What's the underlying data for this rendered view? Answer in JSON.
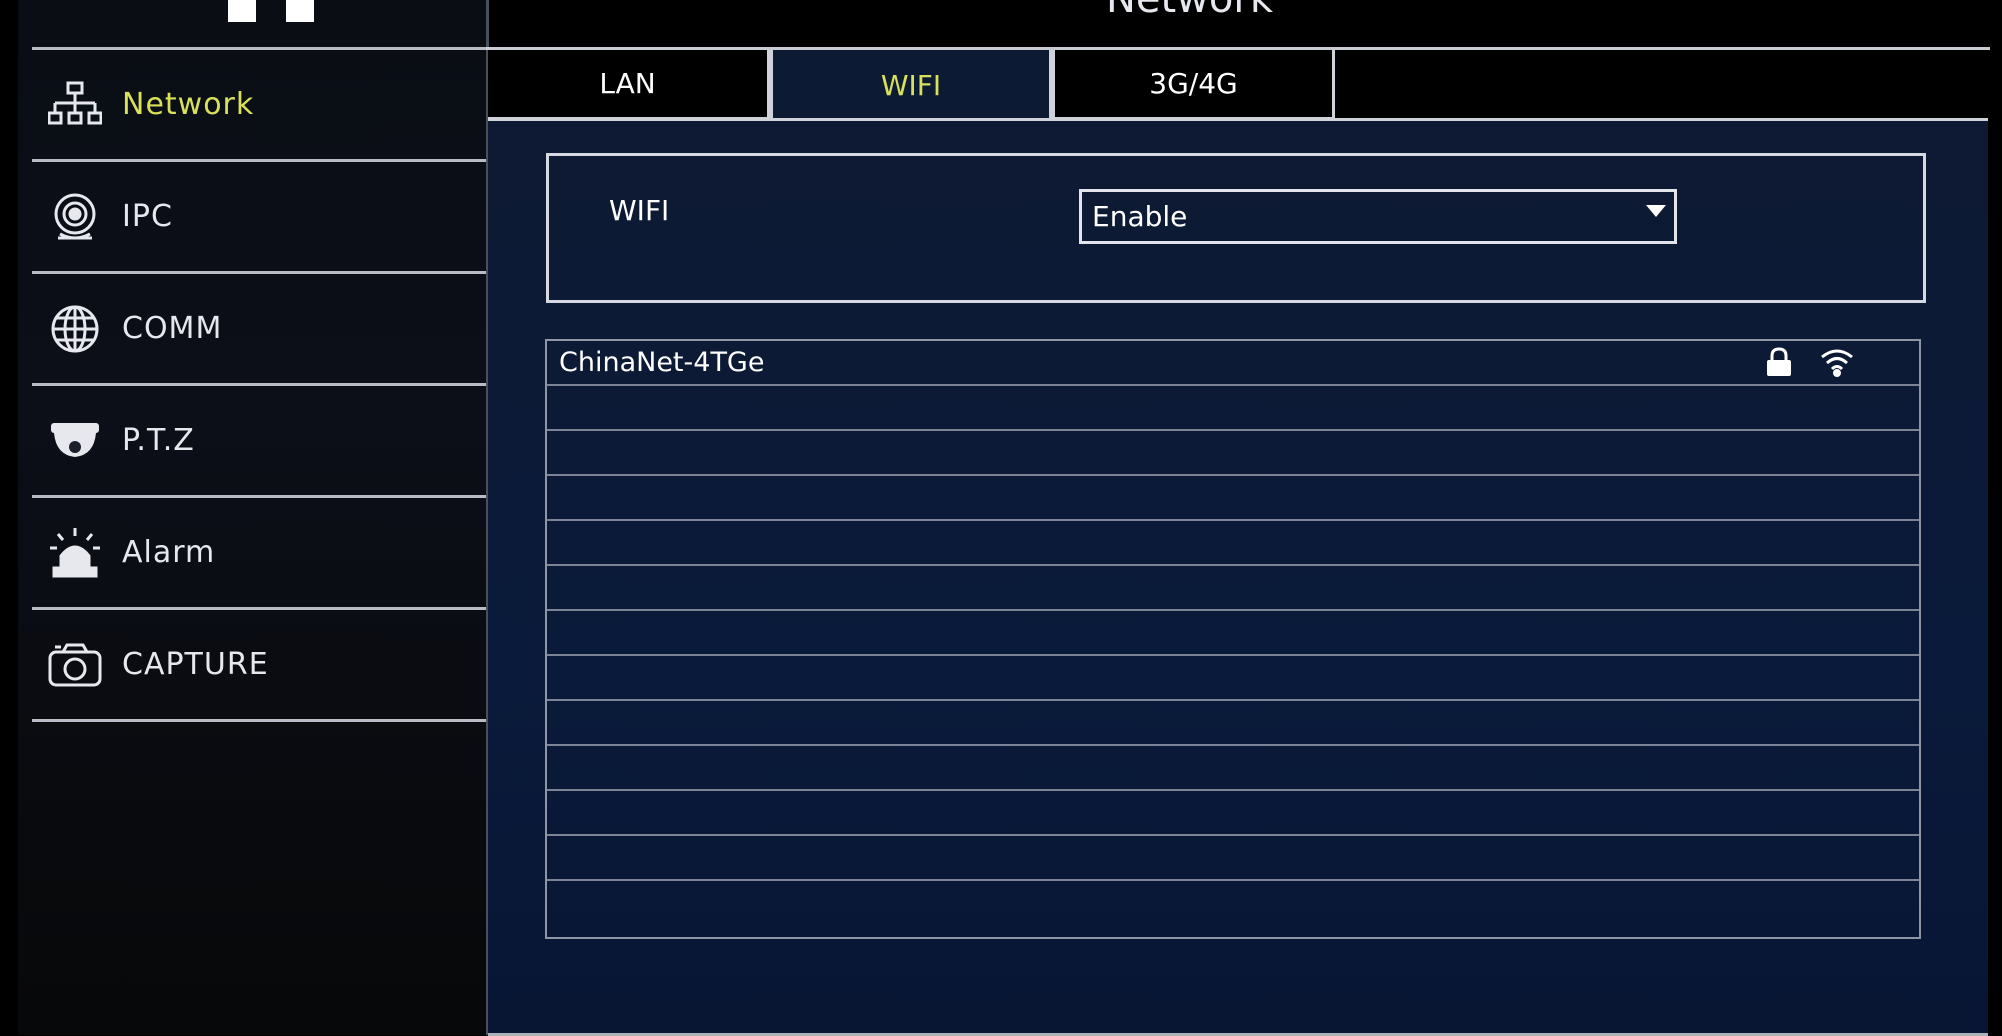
{
  "window": {
    "title": "Network"
  },
  "sidebar": {
    "items": [
      {
        "label": "Network",
        "icon": "network-icon",
        "active": true
      },
      {
        "label": "IPC",
        "icon": "ipc-camera-icon",
        "active": false
      },
      {
        "label": "COMM",
        "icon": "globe-icon",
        "active": false
      },
      {
        "label": "P.T.Z",
        "icon": "dome-camera-icon",
        "active": false
      },
      {
        "label": "Alarm",
        "icon": "alarm-siren-icon",
        "active": false
      },
      {
        "label": "CAPTURE",
        "icon": "camera-icon",
        "active": false
      }
    ]
  },
  "tabs": [
    {
      "label": "LAN",
      "active": false
    },
    {
      "label": "WIFI",
      "active": true
    },
    {
      "label": "3G/4G",
      "active": false
    }
  ],
  "wifi": {
    "label": "WIFI",
    "selected": "Enable"
  },
  "networks": [
    {
      "ssid": "ChinaNet-4TGe",
      "locked": true,
      "icons": [
        "lock-icon",
        "wifi-signal-icon"
      ]
    },
    {
      "ssid": ""
    },
    {
      "ssid": ""
    },
    {
      "ssid": ""
    },
    {
      "ssid": ""
    },
    {
      "ssid": ""
    },
    {
      "ssid": ""
    },
    {
      "ssid": ""
    },
    {
      "ssid": ""
    },
    {
      "ssid": ""
    },
    {
      "ssid": ""
    },
    {
      "ssid": ""
    },
    {
      "ssid": ""
    }
  ],
  "colors": {
    "accent_active": "#d9e05a",
    "panel_bg": "#0a1a3a",
    "border": "#cfd2d8"
  }
}
